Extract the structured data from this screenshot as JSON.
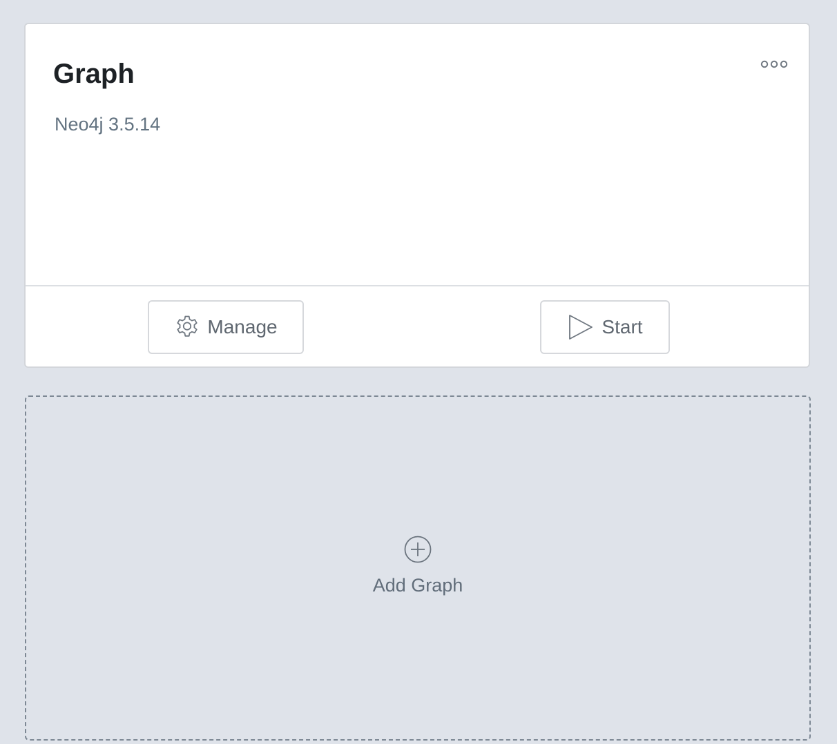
{
  "graph_card": {
    "title": "Graph",
    "subtitle": "Neo4j 3.5.14",
    "more_icon": "more-horizontal-icon",
    "manage_button": {
      "label": "Manage",
      "icon": "gear-icon"
    },
    "start_button": {
      "label": "Start",
      "icon": "play-icon"
    }
  },
  "add_card": {
    "label": "Add Graph",
    "icon": "plus-circle-icon"
  },
  "colors": {
    "background": "#dfe3ea",
    "card_background": "#ffffff",
    "title": "#1d2125",
    "muted_text": "#637381",
    "button_text": "#5f6770",
    "border": "#d3d6db",
    "dashed_border": "#7d8894"
  }
}
